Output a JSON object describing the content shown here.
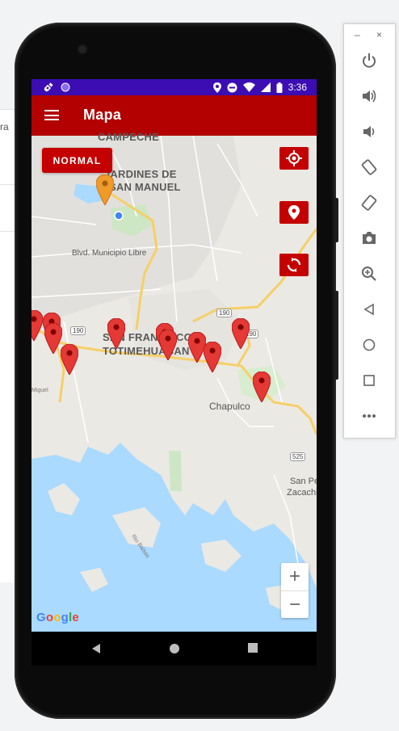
{
  "background": {
    "text": "ra"
  },
  "status_bar": {
    "time": "3:36"
  },
  "app_bar": {
    "title": "Mapa"
  },
  "map": {
    "mode_button": "NORMAL",
    "labels": {
      "campeche": "CAMPECHE",
      "jardines": "JARDINES DE",
      "san_manuel": "SAN MANUEL",
      "blvd_municipio": "Blvd. Municipio Libre",
      "sf_line1": "SAN FRANCISCO",
      "sf_line2": "TOTIMEHUACAN",
      "chapulco": "Chapulco",
      "san_pedro": "San Pe",
      "zacachi": "Zacachi",
      "miguel": "Miguel",
      "rio": "Rio Balsas"
    },
    "shields": {
      "s190a": "190",
      "s190b": "190",
      "s190c": "190",
      "s525": "525"
    },
    "zoom_in": "+",
    "zoom_out": "−",
    "attribution": "Google",
    "colors": {
      "accent": "#c40000",
      "marker": "#e53935",
      "user_pin": "#f09a2a",
      "water": "#aadaff"
    }
  },
  "emulator": {
    "minimize": "–",
    "close": "×"
  }
}
